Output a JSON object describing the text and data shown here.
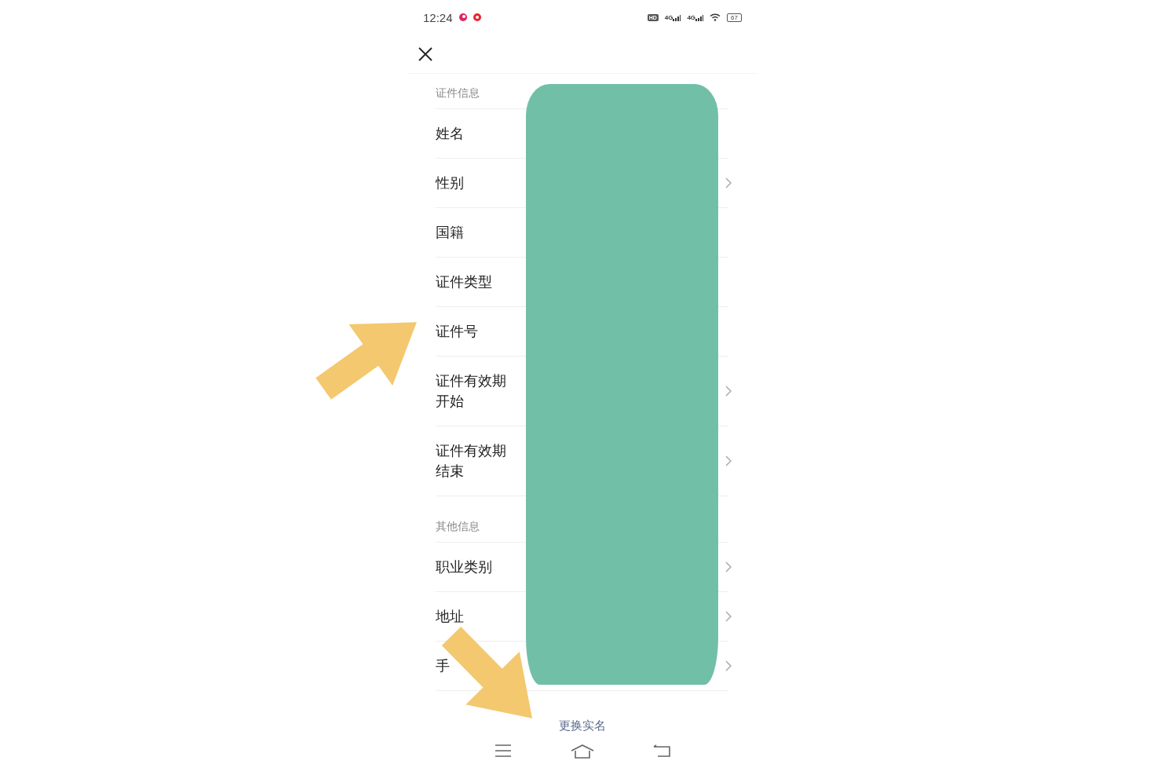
{
  "status_bar": {
    "time": "12:24",
    "hd": "HD",
    "networks": [
      "4G",
      "4G"
    ],
    "battery": "67"
  },
  "sections": [
    {
      "title": "证件信息",
      "rows": [
        {
          "label": "姓名",
          "chevron": false
        },
        {
          "label": "性别",
          "chevron": true
        },
        {
          "label": "国籍",
          "chevron": false
        },
        {
          "label": "证件类型",
          "chevron": false
        },
        {
          "label": "证件号",
          "chevron": false
        },
        {
          "label": "证件有效期开始",
          "chevron": true
        },
        {
          "label": "证件有效期结束",
          "chevron": true
        }
      ]
    },
    {
      "title": "其他信息",
      "rows": [
        {
          "label": "职业类别",
          "chevron": true
        },
        {
          "label": "地址",
          "chevron": true
        },
        {
          "label": "手",
          "chevron": true
        }
      ]
    }
  ],
  "footer_link": "更换实名"
}
